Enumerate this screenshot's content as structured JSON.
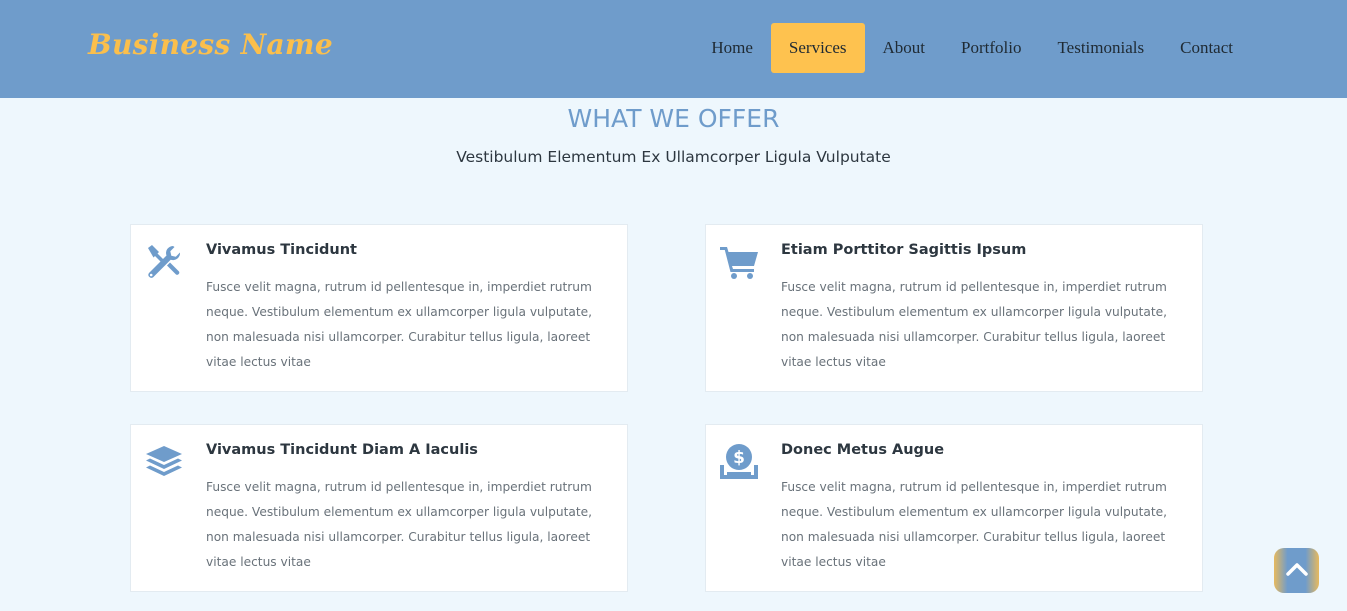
{
  "header": {
    "brand": "Business Name",
    "nav": [
      "Home",
      "Services",
      "About",
      "Portfolio",
      "Testimonials",
      "Contact"
    ],
    "active_nav": "Services"
  },
  "section": {
    "title": "WHAT WE OFFER",
    "subtitle": "Vestibulum Elementum Ex Ullamcorper Ligula Vulputate"
  },
  "services": [
    {
      "icon": "tools-icon",
      "title": "Vivamus Tincidunt",
      "text": "Fusce velit magna, rutrum id pellentesque in, imperdiet rutrum neque. Vestibulum elementum ex ullamcorper ligula vulputate, non malesuada nisi ullamcorper. Curabitur tellus ligula, laoreet vitae lectus vitae"
    },
    {
      "icon": "cart-icon",
      "title": "Etiam Porttitor Sagittis Ipsum",
      "text": "Fusce velit magna, rutrum id pellentesque in, imperdiet rutrum neque. Vestibulum elementum ex ullamcorper ligula vulputate, non malesuada nisi ullamcorper. Curabitur tellus ligula, laoreet vitae lectus vitae"
    },
    {
      "icon": "layers-icon",
      "title": "Vivamus Tincidunt Diam A Iaculis",
      "text": "Fusce velit magna, rutrum id pellentesque in, imperdiet rutrum neque. Vestibulum elementum ex ullamcorper ligula vulputate, non malesuada nisi ullamcorper. Curabitur tellus ligula, laoreet vitae lectus vitae"
    },
    {
      "icon": "money-deposit-icon",
      "title": "Donec Metus Augue",
      "text": "Fusce velit magna, rutrum id pellentesque in, imperdiet rutrum neque. Vestibulum elementum ex ullamcorper ligula vulputate, non malesuada nisi ullamcorper. Curabitur tellus ligula, laoreet vitae lectus vitae"
    }
  ],
  "colors": {
    "header_bg": "#6f9ccb",
    "accent": "#fec24f",
    "page_bg": "#eef7fd",
    "icon": "#6f9ccb"
  },
  "scroll_top_icon": "chevron-up-icon"
}
